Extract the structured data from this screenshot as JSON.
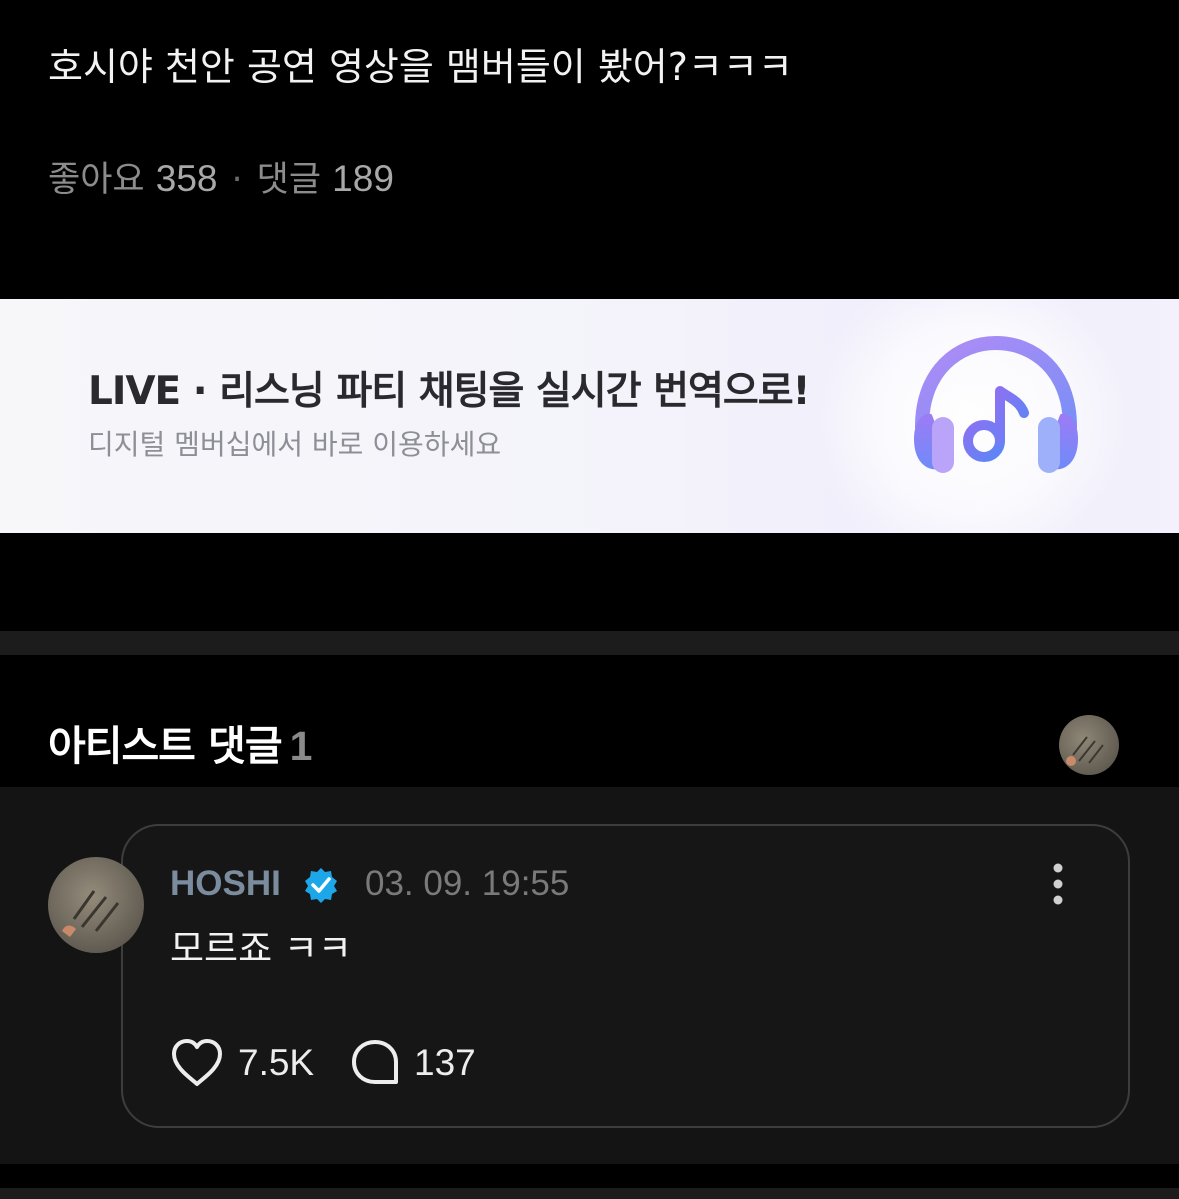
{
  "post": {
    "text": "호시야 천안 공연 영상을 맴버들이 봤어?ㅋㅋㅋ",
    "likes_label": "좋아요",
    "likes_count": "358",
    "separator": "·",
    "comments_label": "댓글",
    "comments_count": "189"
  },
  "banner": {
    "title": "LIVE · 리스닝 파티 채팅을 실시간 번역으로!",
    "subtitle": "디지털 멤버십에서 바로 이용하세요",
    "icon": "headphones-music-icon"
  },
  "artist_comments": {
    "title": "아티스트 댓글",
    "count": "1",
    "comment": {
      "author": "HOSHI",
      "timestamp": "03. 09. 19:55",
      "text": "모르죠 ㅋㅋ",
      "likes": "7.5K",
      "replies": "137"
    }
  },
  "colors": {
    "background": "#000000",
    "author": "#7b8c9e",
    "verified_badge": "#1ea7e8",
    "banner_bg": "#f4f3fb"
  }
}
